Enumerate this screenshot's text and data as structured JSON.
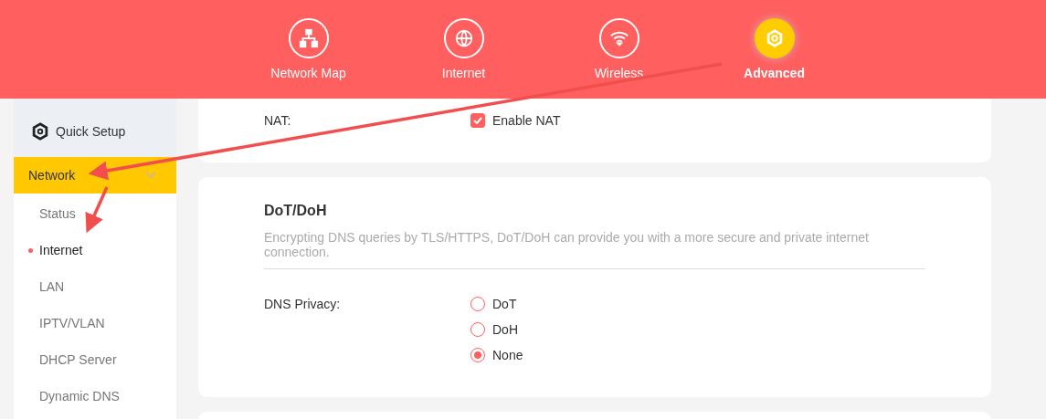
{
  "top_nav": [
    {
      "label": "Network Map",
      "kind": "topology",
      "selected": false
    },
    {
      "label": "Internet",
      "kind": "globe",
      "selected": false
    },
    {
      "label": "Wireless",
      "kind": "wifi",
      "selected": false
    },
    {
      "label": "Advanced",
      "kind": "gear",
      "selected": true
    }
  ],
  "sidebar": {
    "quick_setup": "Quick Setup",
    "section": {
      "label": "Network",
      "expanded": true,
      "selected": true
    },
    "items": [
      {
        "label": "Status",
        "selected": false
      },
      {
        "label": "Internet",
        "selected": true
      },
      {
        "label": "LAN",
        "selected": false
      },
      {
        "label": "IPTV/VLAN",
        "selected": false
      },
      {
        "label": "DHCP Server",
        "selected": false
      },
      {
        "label": "Dynamic DNS",
        "selected": false
      }
    ]
  },
  "nat_card": {
    "label": "NAT:",
    "option": "Enable NAT",
    "checked": true
  },
  "dns_card": {
    "title": "DoT/DoH",
    "description": "Encrypting DNS queries by TLS/HTTPS, DoT/DoH can provide you with a more secure and private internet connection.",
    "label": "DNS Privacy:",
    "options": [
      {
        "label": "DoT",
        "selected": false
      },
      {
        "label": "DoH",
        "selected": false
      },
      {
        "label": "None",
        "selected": true
      }
    ]
  }
}
